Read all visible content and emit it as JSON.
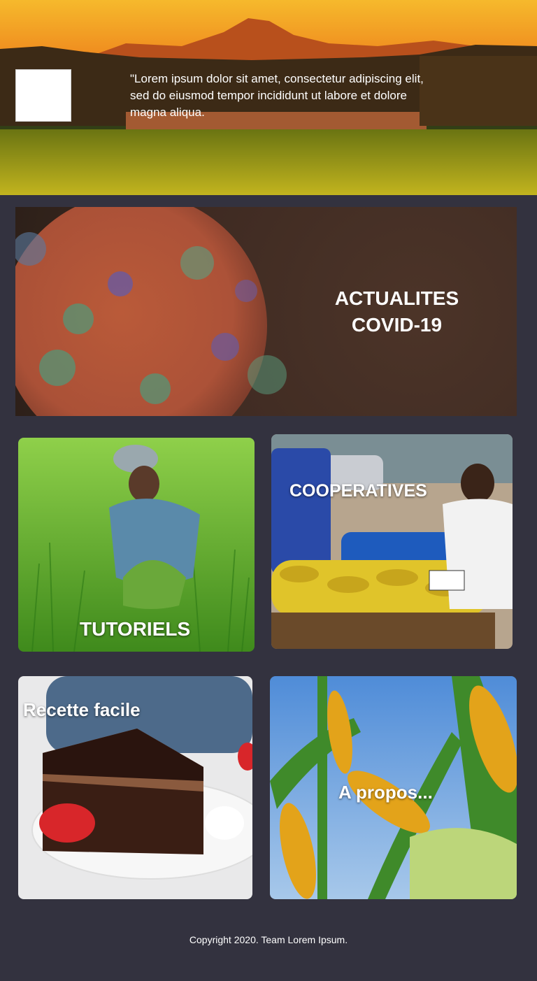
{
  "hero": {
    "text": "\"Lorem ipsum dolor sit amet, consectetur adipiscing elit, sed do eiusmod tempor incididunt ut labore et dolore magna aliqua."
  },
  "covid": {
    "title_line1": "ACTUALITES",
    "title_line2": "COVID-19"
  },
  "cards": {
    "tutoriels": "TUTORIELS",
    "cooperatives": "COOPERATIVES",
    "recette": "Recette facile",
    "apropos": "A propos..."
  },
  "footer": {
    "copyright": "Copyright 2020. Team Lorem Ipsum."
  },
  "colors": {
    "background": "#33323f",
    "text": "#ffffff"
  }
}
